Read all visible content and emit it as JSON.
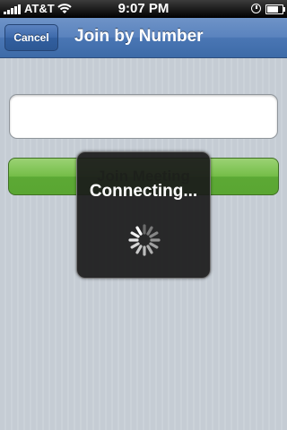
{
  "status_bar": {
    "carrier": "AT&T",
    "time": "9:07 PM",
    "icons": [
      "signal-bars-icon",
      "wifi-icon",
      "clock-icon",
      "battery-icon"
    ]
  },
  "nav": {
    "cancel_label": "Cancel",
    "title": "Join by Number"
  },
  "form": {
    "meeting_number_value": "",
    "join_label": "Join Meeting"
  },
  "overlay": {
    "message": "Connecting...",
    "spinner_icon": "activity-spinner-icon"
  },
  "colors": {
    "nav_blue": "#4a76b4",
    "join_green": "#74bd47",
    "background": "#c5ccd4",
    "hud": "#1a1a1a"
  }
}
